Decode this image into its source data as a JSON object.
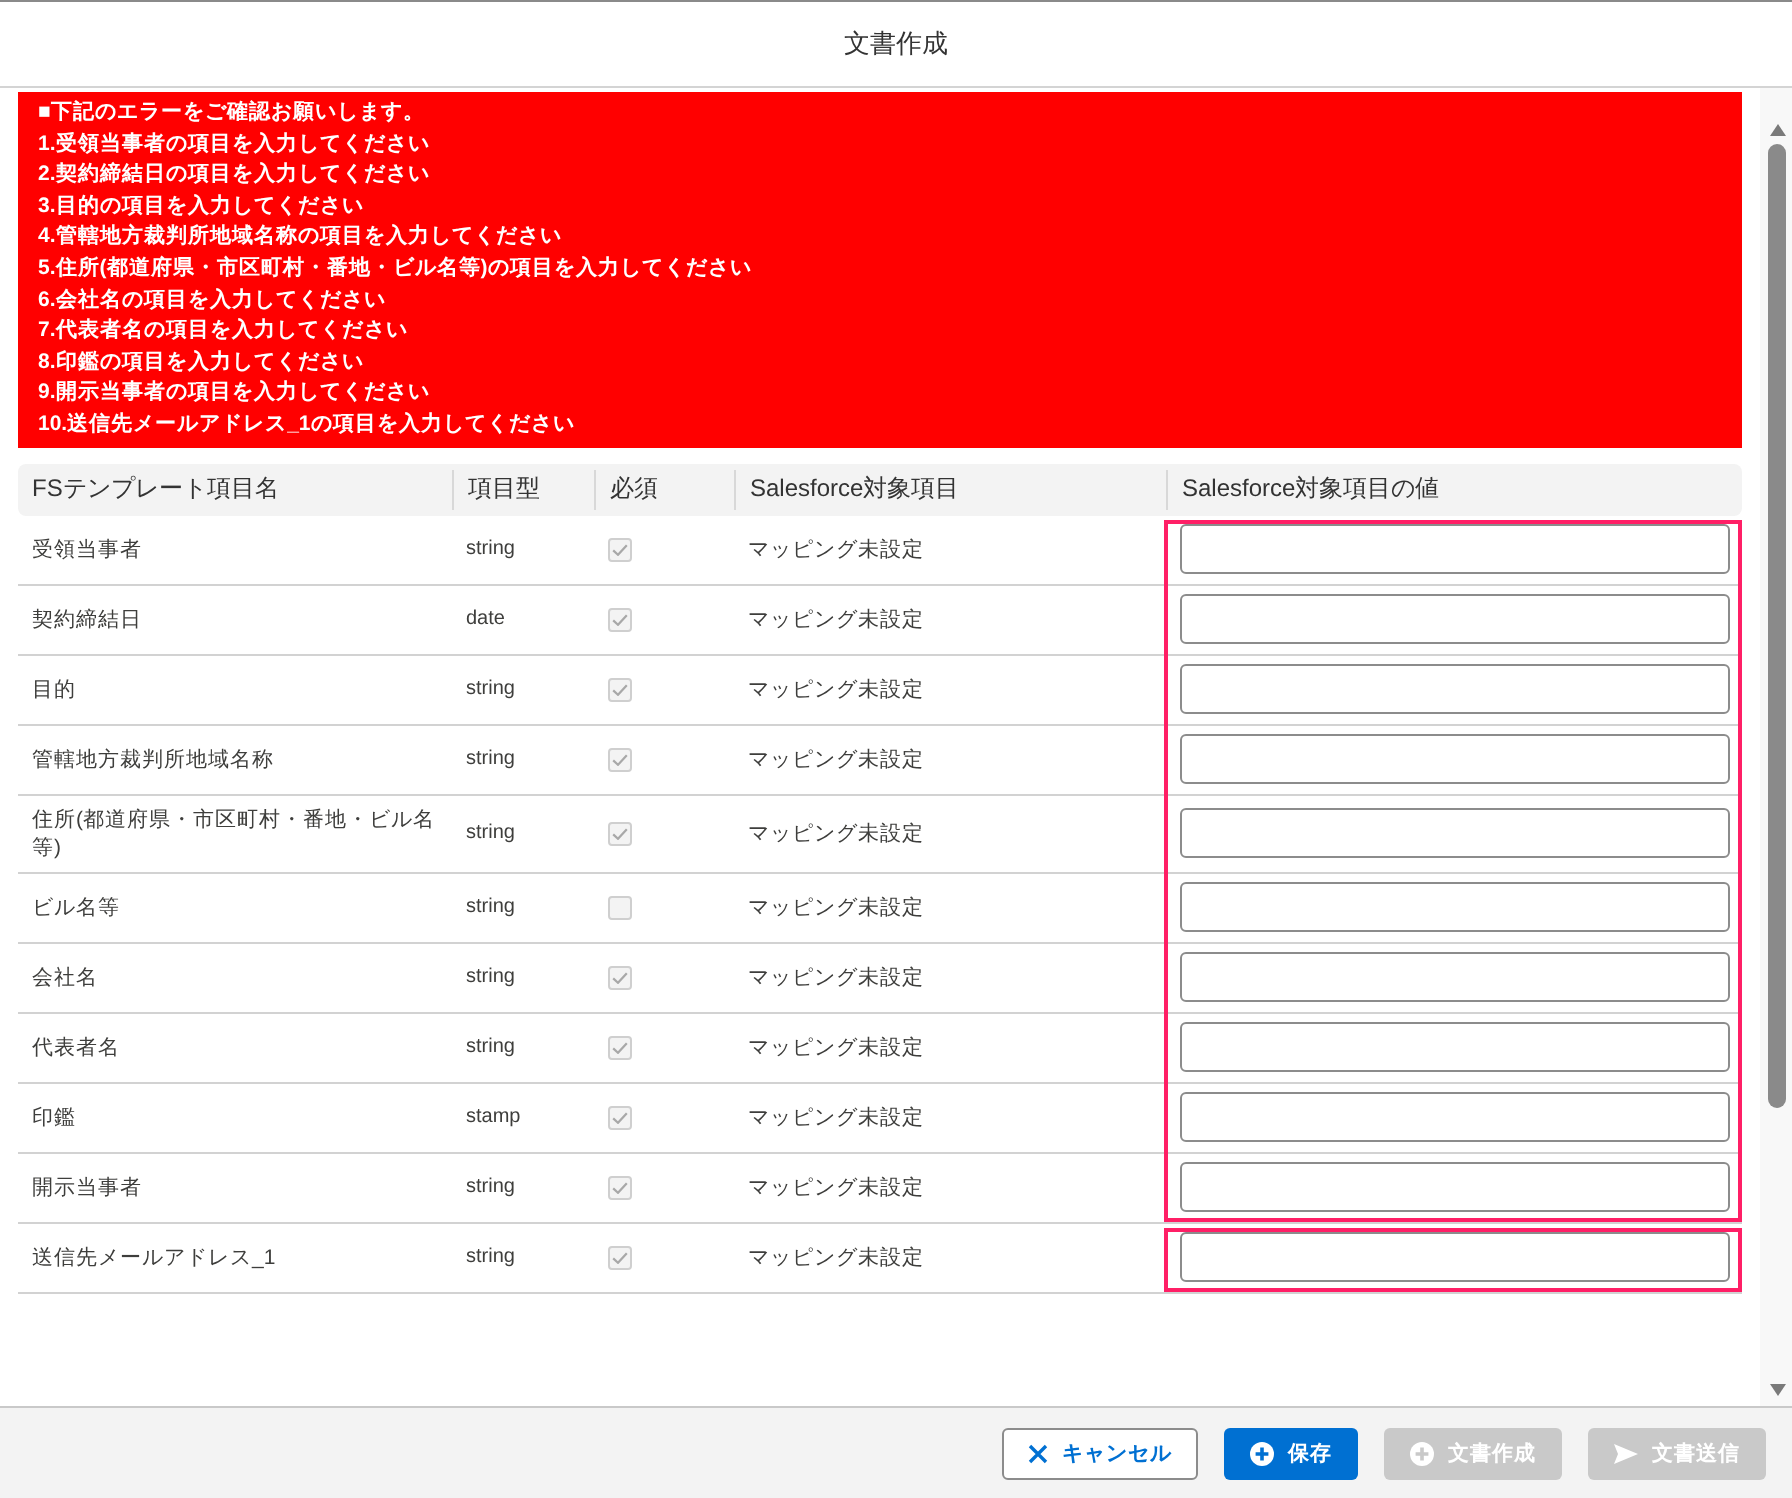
{
  "dialog": {
    "title": "文書作成"
  },
  "errors": {
    "heading": "■下記のエラーをご確認お願いします。",
    "items": [
      "1.受領当事者の項目を入力してください",
      "2.契約締結日の項目を入力してください",
      "3.目的の項目を入力してください",
      "4.管轄地方裁判所地域名称の項目を入力してください",
      "5.住所(都道府県・市区町村・番地・ビル名等)の項目を入力してください",
      "6.会社名の項目を入力してください",
      "7.代表者名の項目を入力してください",
      "8.印鑑の項目を入力してください",
      "9.開示当事者の項目を入力してください",
      "10.送信先メールアドレス_1の項目を入力してください"
    ]
  },
  "table": {
    "columns": [
      "FSテンプレート項目名",
      "項目型",
      "必須",
      "Salesforce対象項目",
      "Salesforce対象項目の値"
    ],
    "row_groups": [
      {
        "highlighted": true,
        "rows": [
          {
            "name": "受領当事者",
            "type": "string",
            "required": true,
            "mapping": "マッピング未設定"
          },
          {
            "name": "契約締結日",
            "type": "date",
            "required": true,
            "mapping": "マッピング未設定"
          },
          {
            "name": "目的",
            "type": "string",
            "required": true,
            "mapping": "マッピング未設定"
          },
          {
            "name": "管轄地方裁判所地域名称",
            "type": "string",
            "required": true,
            "mapping": "マッピング未設定"
          },
          {
            "name": "住所(都道府県・市区町村・番地・ビル名等)",
            "type": "string",
            "required": true,
            "mapping": "マッピング未設定"
          },
          {
            "name": "ビル名等",
            "type": "string",
            "required": false,
            "mapping": "マッピング未設定"
          },
          {
            "name": "会社名",
            "type": "string",
            "required": true,
            "mapping": "マッピング未設定"
          },
          {
            "name": "代表者名",
            "type": "string",
            "required": true,
            "mapping": "マッピング未設定"
          },
          {
            "name": "印鑑",
            "type": "stamp",
            "required": true,
            "mapping": "マッピング未設定"
          },
          {
            "name": "開示当事者",
            "type": "string",
            "required": true,
            "mapping": "マッピング未設定"
          }
        ]
      },
      {
        "highlighted": true,
        "rows": [
          {
            "name": "送信先メールアドレス_1",
            "type": "string",
            "required": true,
            "mapping": "マッピング未設定"
          }
        ]
      }
    ]
  },
  "buttons": [
    {
      "label": "キャンセル",
      "kind": "cancel",
      "disabled": false
    },
    {
      "label": "保存",
      "kind": "save",
      "disabled": false
    },
    {
      "label": "文書作成",
      "kind": "create",
      "disabled": true
    },
    {
      "label": "文書送信",
      "kind": "send",
      "disabled": true
    }
  ]
}
